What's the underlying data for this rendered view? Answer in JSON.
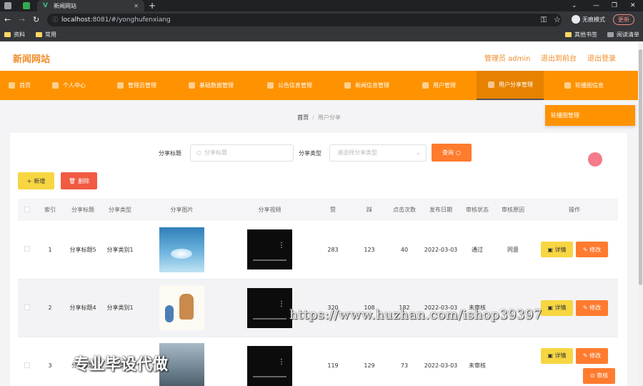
{
  "browser": {
    "tab_title": "新闻网站",
    "url_host": "localhost",
    "url_rest": ":8081/#/yonghufenxiang",
    "incognito_label": "无痕模式",
    "update_label": "更新",
    "bookmarks": [
      "资料",
      "常用"
    ],
    "bookmarks_right": [
      "其他书签",
      "阅读清单"
    ]
  },
  "header": {
    "brand": "新闻网站",
    "admin_label": "管理员 admin",
    "front_label": "退出到前台",
    "logout_label": "退出登录"
  },
  "menu": {
    "items": [
      {
        "label": "首页",
        "icon": "home-icon"
      },
      {
        "label": "个人中心",
        "icon": "user-icon"
      },
      {
        "label": "管理员管理",
        "icon": "admin-icon"
      },
      {
        "label": "基础数据管理",
        "icon": "data-icon"
      },
      {
        "label": "公告信息管理",
        "icon": "notice-icon"
      },
      {
        "label": "新闻信息管理",
        "icon": "news-icon"
      },
      {
        "label": "用户管理",
        "icon": "users-icon"
      },
      {
        "label": "用户分享管理",
        "icon": "share-icon"
      },
      {
        "label": "轮播图信息",
        "icon": "carousel-icon"
      }
    ],
    "active_index": 7,
    "dropdown_item": "轮播图管理"
  },
  "breadcrumb": {
    "home": "首页",
    "sep": "/",
    "current": "用户分享"
  },
  "search": {
    "title_label": "分享标题",
    "title_placeholder": "分享标题",
    "type_label": "分享类型",
    "type_placeholder": "请选择分享类型",
    "query_label": "查询"
  },
  "toolbar": {
    "add_label": "新增",
    "delete_label": "删除"
  },
  "table": {
    "columns": [
      "索引",
      "分享标题",
      "分享类型",
      "分享图片",
      "分享视频",
      "赞",
      "踩",
      "点击次数",
      "发布日期",
      "审核状态",
      "审核原因",
      "操作"
    ],
    "rows": [
      {
        "index": "1",
        "title": "分享标题5",
        "type": "分享类别1",
        "likes": "283",
        "dislikes": "123",
        "clicks": "40",
        "date": "2022-03-03",
        "status": "通过",
        "reason": "同意"
      },
      {
        "index": "2",
        "title": "分享标题4",
        "type": "分享类别1",
        "likes": "320",
        "dislikes": "108",
        "clicks": "182",
        "date": "2022-03-03",
        "status": "未审核",
        "reason": ""
      },
      {
        "index": "3",
        "title": "分享标题",
        "type": "分享类别",
        "likes": "119",
        "dislikes": "129",
        "clicks": "73",
        "date": "2022-03-03",
        "status": "未审核",
        "reason": ""
      }
    ],
    "detail_label": "详情",
    "edit_label": "修改",
    "review_label": "审核"
  },
  "overlay": {
    "watermark_url": "https://www.huzhan.com/ishop39397",
    "watermark_text": "专业毕设代做"
  }
}
